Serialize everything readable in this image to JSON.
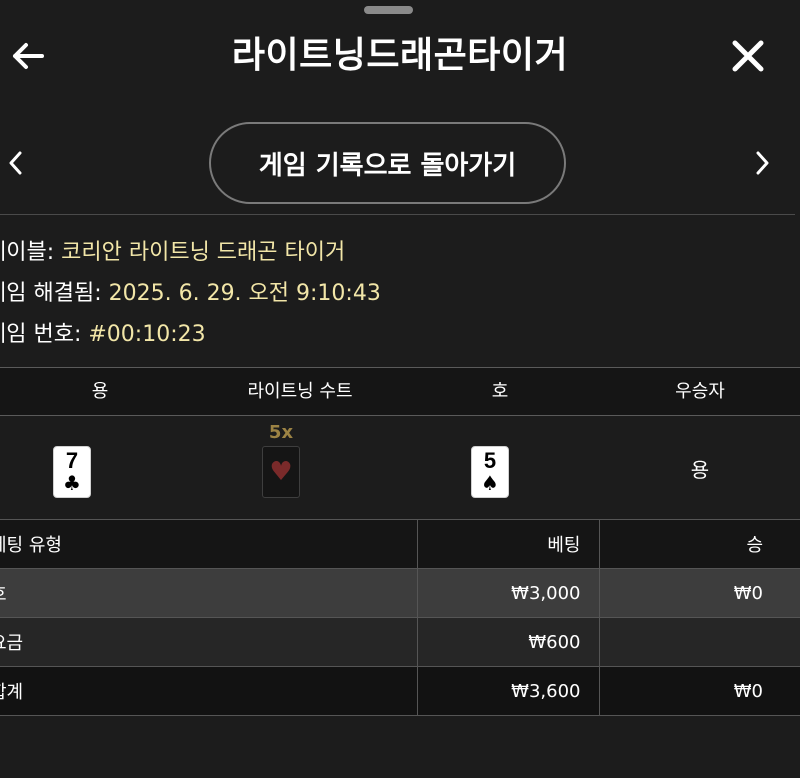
{
  "header": {
    "title": "라이트닝드래곤타이거"
  },
  "nav": {
    "back_to_history_label": "게임 기록으로 돌아가기"
  },
  "info": {
    "table_label": "테이블:",
    "table_value": "코리안 라이트닝 드래곤 타이거",
    "resolved_label": "게임 해결됨:",
    "resolved_value": "2025. 6. 29. 오전 9:10:43",
    "number_label": "게임 번호:",
    "number_value": "#00:10:23"
  },
  "result": {
    "columns": [
      "용",
      "라이트닝 수트",
      "호",
      "우승자"
    ],
    "dragon_card": {
      "rank": "7",
      "suit": "♣"
    },
    "lightning_multiplier": "5x",
    "lightning_suit": "♥",
    "tiger_card": {
      "rank": "5",
      "suit": "♠"
    },
    "winner": "용"
  },
  "bets": {
    "headers": [
      "베팅 유형",
      "베팅",
      "승"
    ],
    "rows": [
      {
        "type": "호",
        "bet": "₩3,000",
        "win": "₩0"
      },
      {
        "type": "요금",
        "bet": "₩600",
        "win": ""
      },
      {
        "type": "합계",
        "bet": "₩3,600",
        "win": "₩0"
      }
    ]
  },
  "colors": {
    "background": "#1c1c1c",
    "info_value": "#f2e6a8",
    "multiplier": "#9c8344",
    "row_highlight": "#3d3d3d"
  },
  "icons": {
    "back": "arrow-left-icon",
    "close": "close-icon",
    "prev": "chevron-left-icon",
    "next": "chevron-right-icon",
    "lightning_suit": "heart-icon"
  }
}
